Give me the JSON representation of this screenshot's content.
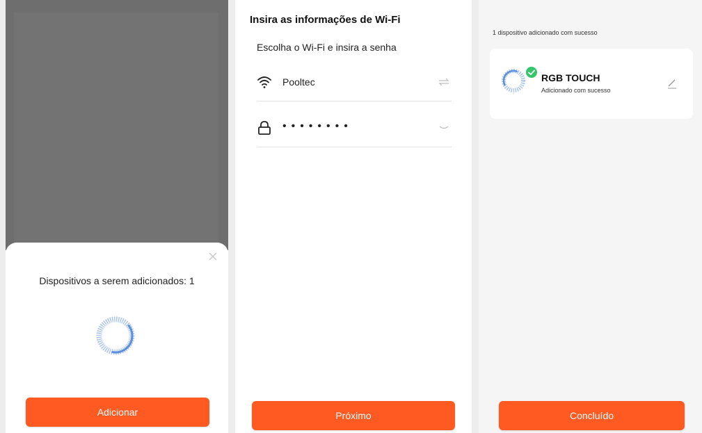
{
  "panel_add": {
    "sheet_title": "Dispositivos a serem adicionados: 1",
    "add_button": "Adicionar",
    "close_icon": "close-icon",
    "spinner_icon": "loading-spinner-icon"
  },
  "panel_wifi": {
    "title": "Insira as informações de Wi-Fi",
    "subtitle": "Escolha o Wi-Fi e insira a senha",
    "network_name": "Pooltec",
    "password_masked": "••••••••",
    "next_button": "Próximo",
    "icons": [
      "wifi-icon",
      "switch-network-icon",
      "lock-icon",
      "eye-closed-icon"
    ]
  },
  "panel_done": {
    "success_summary": "1 dispositivo adicionado com sucesso",
    "device_name": "RGB TOUCH",
    "device_status": "Adicionado com sucesso",
    "done_button": "Concluído",
    "icons": [
      "device-icon",
      "check-badge-icon",
      "edit-icon"
    ]
  },
  "colors": {
    "accent": "#ff5a22",
    "success": "#35c56a",
    "dim_overlay": "#6e6e6e"
  }
}
